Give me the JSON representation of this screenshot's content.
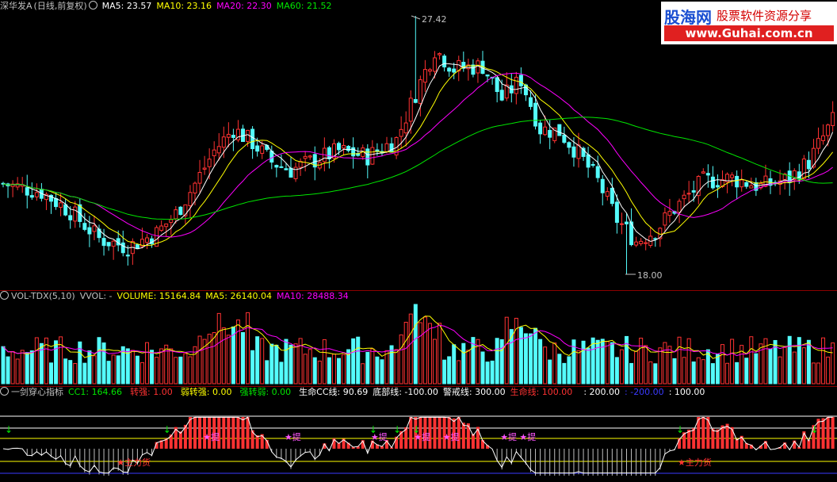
{
  "header_price": {
    "stock": "深华发A",
    "mode": "(日线,前复权)",
    "menu_icon": "dropdown-circle-icon",
    "ma5": "MA5: 23.57",
    "ma10": "MA10: 23.16",
    "ma20": "MA20: 22.30",
    "ma60": "MA60: 21.52"
  },
  "header_vol": {
    "name": "VOL-TDX(5,10)",
    "vvol": "VVOL: -",
    "volume": "VOLUME: 15164.84",
    "ma5": "MA5: 26140.04",
    "ma10": "MA10: 28488.34"
  },
  "header_ind": {
    "name": "一剑穿心指标",
    "cc1": "CC1: 164.66",
    "zq": "转强: 1.00",
    "rzq": "弱转强: 0.00",
    "qzr": "强转弱: 0.00",
    "life": "生命CC线: 90.69",
    "bottom": "底部线: -100.00",
    "warn": "警戒线: 300.00",
    "lifeline": "生命线: 100.00",
    "v200": ": 200.00",
    "vneg200": ": -200.00",
    "v100": ": 100.00"
  },
  "logo": {
    "brand": "股海网",
    "slogan": "股票软件资源分享",
    "url": "www.Guhai.com.cn"
  },
  "colors": {
    "up": "#ff3232",
    "down": "#54fcfc",
    "ma5": "#ffffff",
    "ma10": "#ffff00",
    "ma20": "#ff00ff",
    "ma60": "#00e600",
    "signal": "#ff55ff",
    "separator": "#8b0000"
  },
  "chart_data": {
    "type": "candlestick",
    "price_max": 27.42,
    "price_min": 18.0,
    "max_label": "27.42",
    "min_label": "18.00",
    "candle_count": 174,
    "markers": {
      "ti": "提",
      "dong": "主力货"
    }
  }
}
